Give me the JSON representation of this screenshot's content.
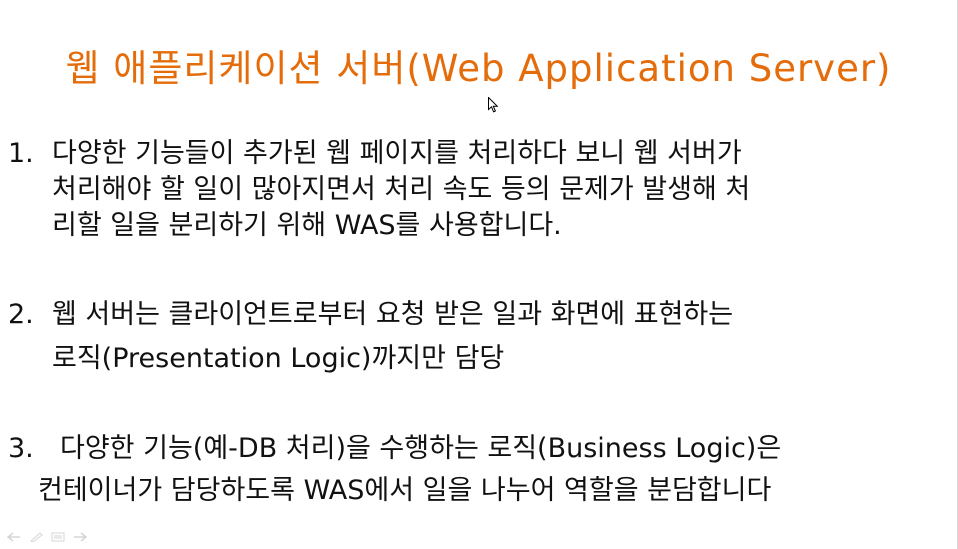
{
  "slide": {
    "title": "웹 애플리케이션 서버(Web Application Server)",
    "items": [
      {
        "number": "1.",
        "lines": [
          "다양한 기능들이 추가된 웹 페이지를 처리하다 보니 웹 서버가",
          "처리해야 할 일이 많아지면서 처리 속도 등의 문제가 발생해 처",
          "리할 일을 분리하기 위해 WAS를 사용합니다."
        ]
      },
      {
        "number": "2.",
        "lines": [
          "웹 서버는 클라이언트로부터 요청 받은 일과 화면에 표현하는",
          "로직(Presentation Logic)까지만 담당"
        ]
      },
      {
        "number": "3.",
        "lines": [
          "다양한 기능(예-DB 처리)을 수행하는 로직(Business Logic)은",
          "컨테이너가 담당하도록 WAS에서 일을 나누어 역할을 분담합니다"
        ]
      }
    ]
  },
  "colors": {
    "title": "#e46c0a",
    "body_text": "#111111",
    "background": "#ffffff"
  },
  "toolbar": {
    "icons": [
      "back-arrow-icon",
      "pen-icon",
      "menu-icon",
      "forward-arrow-icon"
    ]
  }
}
